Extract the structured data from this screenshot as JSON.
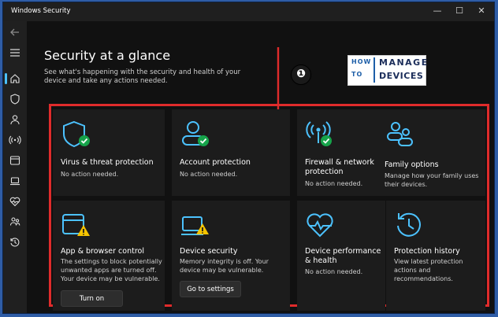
{
  "window": {
    "title": "Windows Security",
    "minimize": "—",
    "maximize": "☐",
    "close": "✕"
  },
  "sidebar": {
    "items": [
      {
        "icon": "back-arrow-icon"
      },
      {
        "icon": "menu-icon"
      },
      {
        "icon": "home-icon",
        "selected": true
      },
      {
        "icon": "shield-icon"
      },
      {
        "icon": "person-icon"
      },
      {
        "icon": "wifi-signal-icon"
      },
      {
        "icon": "app-window-icon"
      },
      {
        "icon": "laptop-icon"
      },
      {
        "icon": "heart-pulse-icon"
      },
      {
        "icon": "family-icon"
      },
      {
        "icon": "history-icon"
      }
    ]
  },
  "main": {
    "title": "Security at a glance",
    "subtitle": "See what's happening with the security and health of your device and take any actions needed."
  },
  "logo": {
    "how": "HOW",
    "to": "TO",
    "manage": "MANAGE",
    "devices": "DEVICES"
  },
  "annotation": {
    "step": "❶"
  },
  "colors": {
    "accent": "#4cc2ff",
    "ok": "#16a34a",
    "warn": "#f5c400",
    "highlight": "#e02b2b"
  },
  "cards": [
    {
      "icon": "shield-check-icon",
      "title": "Virus & threat protection",
      "desc": "No action needed.",
      "status": "ok"
    },
    {
      "icon": "account-check-icon",
      "title": "Account protection",
      "desc": "No action needed.",
      "status": "ok"
    },
    {
      "icon": "firewall-check-icon",
      "title": "Firewall & network protection",
      "desc": "No action needed.",
      "status": "ok"
    },
    {
      "icon": "family-options-icon",
      "title": "Family options",
      "desc": "Manage how your family uses their devices.",
      "status": "info"
    },
    {
      "icon": "app-browser-warning-icon",
      "title": "App & browser control",
      "desc": "The settings to block potentially unwanted apps are turned off. Your device may be vulnerable.",
      "status": "warn",
      "button": "Turn on"
    },
    {
      "icon": "device-security-warning-icon",
      "title": "Device security",
      "desc": "Memory integrity is off. Your device may be vulnerable.",
      "status": "warn",
      "button": "Go to settings"
    },
    {
      "icon": "device-performance-icon",
      "title": "Device performance & health",
      "desc": "No action needed.",
      "status": "info"
    },
    {
      "icon": "protection-history-icon",
      "title": "Protection history",
      "desc": "View latest protection actions and recommendations.",
      "status": "info"
    }
  ]
}
